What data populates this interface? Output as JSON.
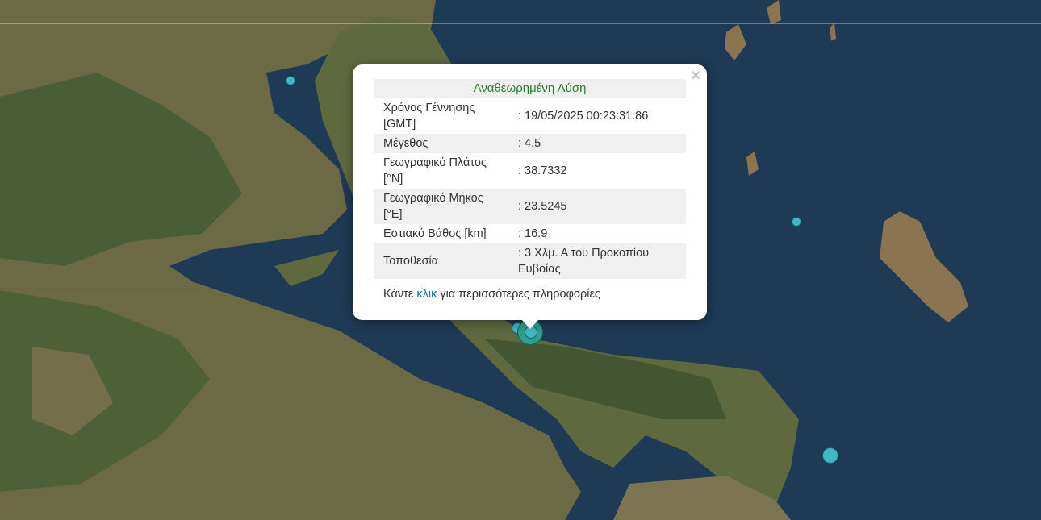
{
  "map": {
    "colors": {
      "sea": "#1f3a55",
      "land": "#6a6a40",
      "forest": "#2f4a2a",
      "marker": "#3fb8c4"
    }
  },
  "popup": {
    "title": "Αναθεωρημένη Λύση",
    "rows": [
      {
        "label": "Χρόνος Γέννησης [GMT]",
        "value": ": 19/05/2025 00:23:31.86"
      },
      {
        "label": "Μέγεθος",
        "value": ": 4.5"
      },
      {
        "label": "Γεωγραφικό Πλάτος [°N]",
        "value": ": 38.7332"
      },
      {
        "label": "Γεωγραφικό Μήκος [°E]",
        "value": ": 23.5245"
      },
      {
        "label": "Εστιακό Βάθος [km]",
        "value": ": 16.9"
      },
      {
        "label": "Τοποθεσία",
        "value": ": 3 Χλμ. Α του Προκοπίου Ευβοίας"
      }
    ],
    "footer": {
      "prefix": "Κάντε",
      "link": "κλικ",
      "suffix": "για περισσότερες πληροφορίες"
    },
    "close_label": "×"
  }
}
